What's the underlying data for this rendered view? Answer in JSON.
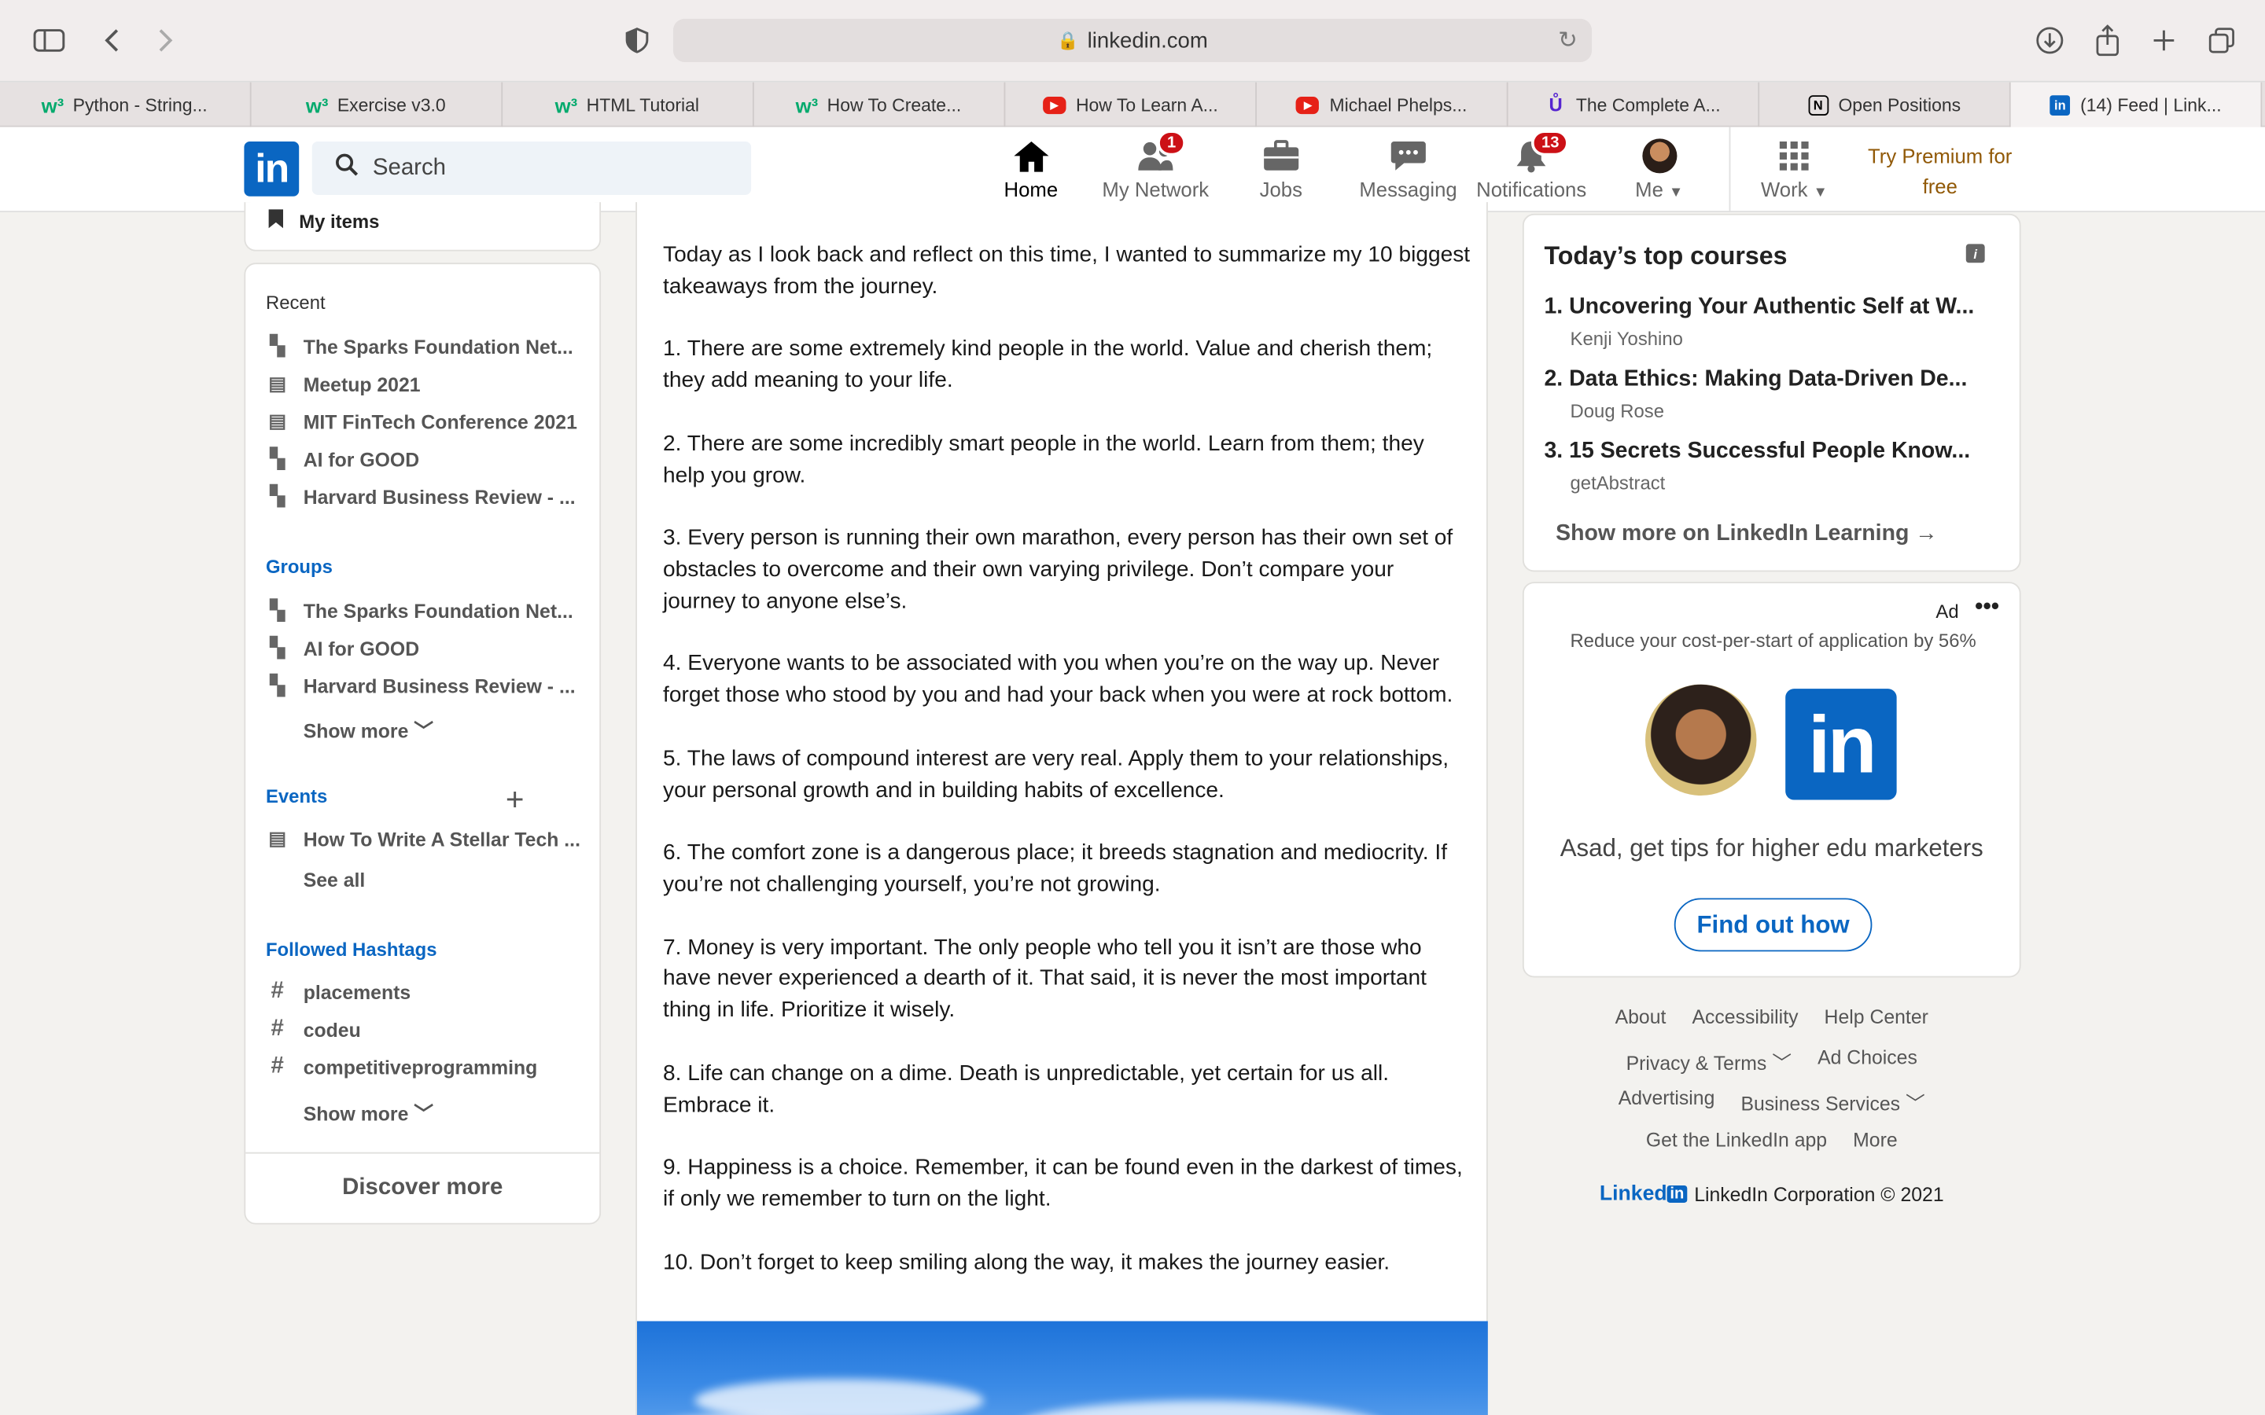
{
  "browser": {
    "url": "linkedin.com",
    "tabs": [
      {
        "label": "Python - String...",
        "icon": "w3"
      },
      {
        "label": "Exercise v3.0",
        "icon": "w3"
      },
      {
        "label": "HTML Tutorial",
        "icon": "w3"
      },
      {
        "label": "How To Create...",
        "icon": "w3"
      },
      {
        "label": "How To Learn A...",
        "icon": "youtube"
      },
      {
        "label": "Michael Phelps...",
        "icon": "youtube"
      },
      {
        "label": "The Complete A...",
        "icon": "udemy"
      },
      {
        "label": "Open Positions",
        "icon": "notion"
      },
      {
        "label": "(14) Feed | Link...",
        "icon": "linkedin"
      }
    ]
  },
  "nav": {
    "logo": "in",
    "search_placeholder": "Search",
    "home": "Home",
    "network": "My Network",
    "network_badge": "1",
    "jobs": "Jobs",
    "messaging": "Messaging",
    "notifications": "Notifications",
    "notifications_badge": "13",
    "me": "Me",
    "work": "Work",
    "premium": "Try Premium for free"
  },
  "left": {
    "my_items": "My items",
    "recent_title": "Recent",
    "recent": [
      {
        "label": "The Sparks Foundation Net...",
        "icon": "group-icon"
      },
      {
        "label": "Meetup 2021",
        "icon": "calendar-icon"
      },
      {
        "label": "MIT FinTech Conference 2021",
        "icon": "calendar-icon"
      },
      {
        "label": "AI for GOOD",
        "icon": "group-icon"
      },
      {
        "label": "Harvard Business Review - ...",
        "icon": "group-icon"
      }
    ],
    "groups_title": "Groups",
    "groups": [
      {
        "label": "The Sparks Foundation Net..."
      },
      {
        "label": "AI for GOOD"
      },
      {
        "label": "Harvard Business Review - ..."
      }
    ],
    "groups_show_more": "Show more",
    "events_title": "Events",
    "events": [
      {
        "label": "How To Write A Stellar Tech ..."
      }
    ],
    "events_see_all": "See all",
    "hashtags_title": "Followed Hashtags",
    "hashtags": [
      {
        "label": "placements"
      },
      {
        "label": "codeu"
      },
      {
        "label": "competitiveprogramming"
      }
    ],
    "hashtags_show_more": "Show more",
    "discover_more": "Discover more"
  },
  "post": {
    "paragraphs": [
      "Today as I look back and reflect on this time, I wanted to summarize my 10 biggest takeaways from the journey.",
      "1. There are some extremely kind people in the world. Value and cherish them; they add meaning to your life.",
      "2. There are some incredibly smart people in the world. Learn from them; they help you grow.",
      "3. Every person is running their own marathon, every person has their own set of obstacles to overcome and their own varying privilege. Don’t compare your journey to anyone else’s.",
      "4. Everyone wants to be associated with you when you’re on the way up. Never forget those who stood by you and had your back when you were at rock bottom.",
      "5. The laws of compound interest are very real. Apply them to your relationships, your personal growth and in building habits of excellence.",
      "6. The comfort zone is a dangerous place; it breeds stagnation and mediocrity. If you’re not challenging yourself, you’re not growing.",
      "7. Money is very important. The only people who tell you it isn’t are those who have never experienced a dearth of it. That said, it is never the most important thing in life. Prioritize it wisely.",
      "8. Life can change on a dime. Death is unpredictable, yet certain for us all. Embrace it.",
      "9. Happiness is a choice. Remember, it can be found even in the darkest of times, if only we remember to turn on the light.",
      "10. Don’t forget to keep smiling along the way, it makes the journey easier."
    ]
  },
  "courses": {
    "title": "Today’s top courses",
    "items": [
      {
        "title": "1. Uncovering Your Authentic Self at W...",
        "author": "Kenji Yoshino"
      },
      {
        "title": "2. Data Ethics: Making Data-Driven De...",
        "author": "Doug Rose"
      },
      {
        "title": "3. 15 Secrets Successful People Know...",
        "author": "getAbstract"
      }
    ],
    "show_more": "Show more on LinkedIn Learning"
  },
  "ad": {
    "label": "Ad",
    "description": "Reduce your cost-per-start of application by 56%",
    "logo": "in",
    "tip": "Asad, get tips for higher edu marketers",
    "cta": "Find out how"
  },
  "footer": {
    "about": "About",
    "accessibility": "Accessibility",
    "help": "Help Center",
    "privacy": "Privacy & Terms",
    "adchoices": "Ad Choices",
    "advertising": "Advertising",
    "business": "Business Services",
    "app": "Get the LinkedIn app",
    "more": "More",
    "brand_text": "Linked",
    "brand_box": "in",
    "copyright": "LinkedIn Corporation © 2021"
  }
}
